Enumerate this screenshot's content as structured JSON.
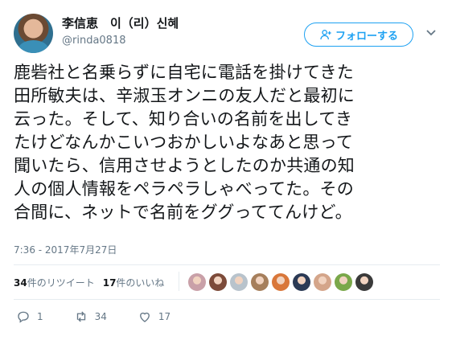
{
  "author": {
    "name": "李信恵　이（리）신혜",
    "handle": "@rinda0818"
  },
  "follow_button": {
    "label": "フォローする",
    "icon": "add-user-icon"
  },
  "tweet": {
    "lines": [
      "鹿砦社と名乗らずに自宅に電話を掛けてきた",
      "田所敏夫は、辛淑玉オンニの友人だと最初に",
      "云った。そして、知り合いの名前を出してき",
      "たけどなんかこいつおかしいよなあと思って",
      "聞いたら、信用させようとしたのか共通の知",
      "人の個人情報をペラペラしゃべってた。その",
      "合間に、ネットで名前をググっててんけど。"
    ],
    "timestamp": "7:36 - 2017年7月27日"
  },
  "stats": {
    "retweets_count": "34",
    "retweets_label": "件のリツイート",
    "likes_count": "17",
    "likes_label": "件のいいね"
  },
  "liker_avatars": [
    "#c9a0a8",
    "#7d4b3a",
    "#b8c3cc",
    "#a67f5c",
    "#d9773a",
    "#2b3a55",
    "#d4a58a",
    "#7aa84a",
    "#3a3a3a"
  ],
  "actions": {
    "reply_count": "1",
    "retweet_count": "34",
    "like_count": "17"
  },
  "colors": {
    "accent": "#1da1f2",
    "muted": "#657786",
    "text": "#14171a"
  }
}
